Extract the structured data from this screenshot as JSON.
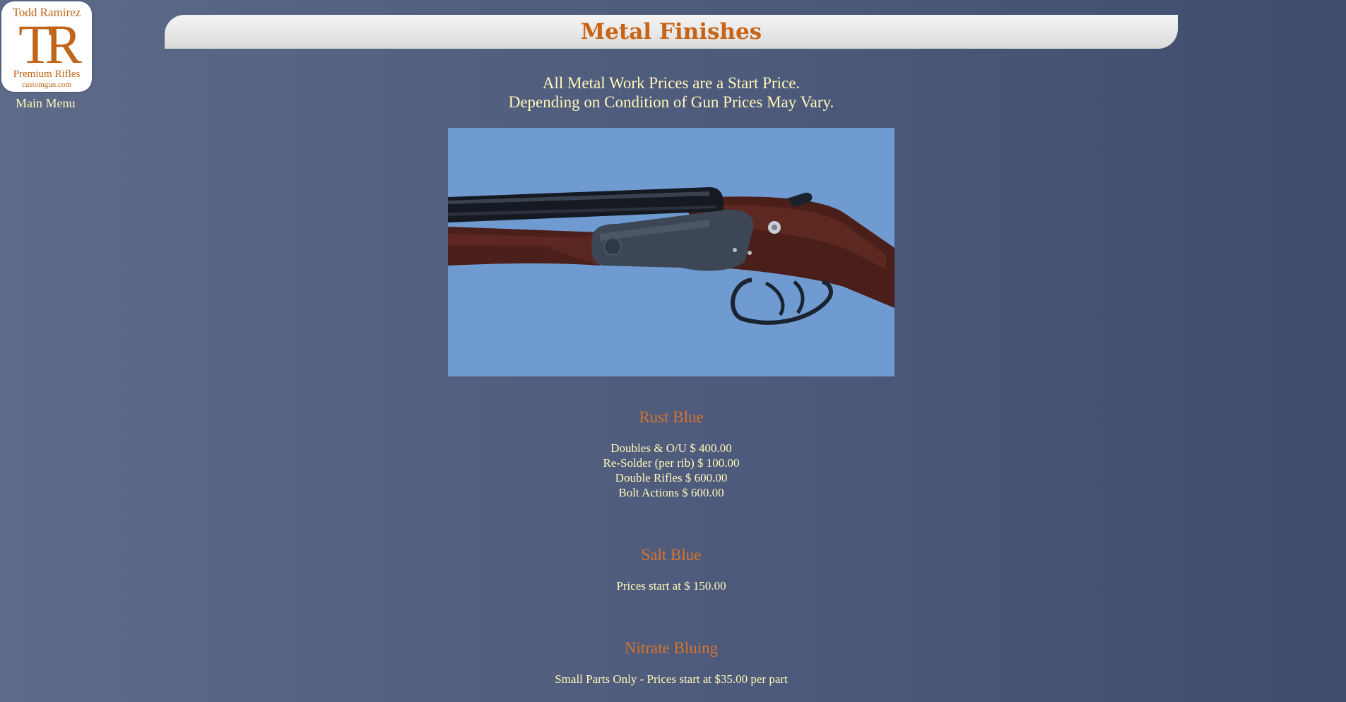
{
  "logo": {
    "top_text": "Todd Ramirez",
    "monogram": "TR",
    "subtitle": "Premium Rifles",
    "site": "customgun.com"
  },
  "nav": {
    "main_menu": "Main Menu"
  },
  "page": {
    "title": "Metal Finishes",
    "notice_line1": "All Metal Work Prices are a Start Price.",
    "notice_line2": "Depending on Condition of Gun Prices May Vary."
  },
  "sections": [
    {
      "heading": "Rust Blue",
      "lines": [
        "Doubles & O/U $ 400.00",
        "Re-Solder (per rib) $ 100.00",
        "Double Rifles $ 600.00",
        "Bolt Actions $ 600.00"
      ]
    },
    {
      "heading": "Salt Blue",
      "lines": [
        "Prices start at $ 150.00"
      ]
    },
    {
      "heading": "Nitrate Bluing",
      "lines": [
        "Small Parts Only - Prices start at $35.00 per part"
      ]
    }
  ],
  "colors": {
    "accent_orange": "#c86416",
    "text_cream": "#fff7b8",
    "photo_background": "#6f9bd1"
  }
}
